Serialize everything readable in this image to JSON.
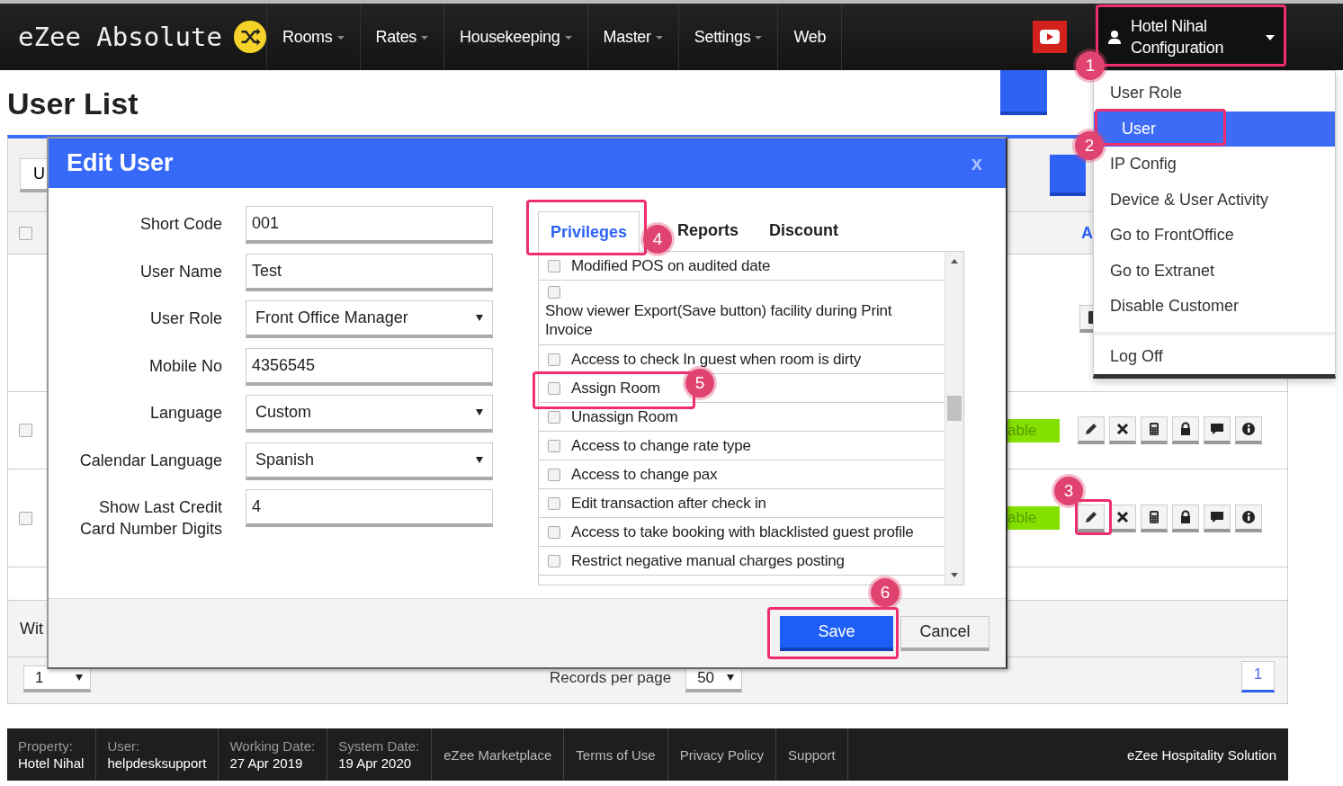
{
  "navbar": {
    "logo": "eZee Absolute",
    "items": [
      {
        "label": "Rooms",
        "dropdown": true
      },
      {
        "label": "Rates",
        "dropdown": true
      },
      {
        "label": "Housekeeping",
        "dropdown": true
      },
      {
        "label": "Master",
        "dropdown": true
      },
      {
        "label": "Settings",
        "dropdown": true
      },
      {
        "label": "Web",
        "dropdown": false
      }
    ],
    "user_menu": {
      "line_1": "Hotel Nihal",
      "line_2": "Configuration",
      "expanded": true
    }
  },
  "page_title": "User List",
  "user_menu_dropdown": {
    "items": [
      {
        "label": "User Role",
        "selected": false
      },
      {
        "label": "User",
        "selected": true
      },
      {
        "label": "IP Config",
        "selected": false
      },
      {
        "label": "Device & User Activity",
        "selected": false
      },
      {
        "label": "Go to FrontOffice",
        "selected": false
      },
      {
        "label": "Go to Extranet",
        "selected": false
      },
      {
        "label": "Disable Customer",
        "selected": false
      }
    ],
    "bottom_item": "Log Off"
  },
  "list_panel": {
    "toolbar_button": "U",
    "header": {
      "checked": false,
      "column_label": "A"
    },
    "rows": [
      {
        "kind": "partial"
      },
      {
        "kind": "user",
        "checked": false,
        "status": "able"
      },
      {
        "kind": "user",
        "checked": false,
        "status": "able"
      }
    ],
    "footer_text": "Wit",
    "page_select": "1",
    "records_label": "Records per page",
    "records_value": "50",
    "pages": [
      {
        "label": "1",
        "selected": true
      }
    ]
  },
  "edit_user_dialog": {
    "title": "Edit User",
    "close": "x",
    "fields": [
      {
        "label": "Short Code",
        "value": "001",
        "kind": "text"
      },
      {
        "label": "User Name",
        "value": "Test",
        "kind": "text"
      },
      {
        "label": "User Role",
        "value": "Front Office Manager",
        "kind": "select"
      },
      {
        "label": "Mobile No",
        "value": "4356545",
        "kind": "text"
      },
      {
        "label": "Language",
        "value": "Custom",
        "kind": "select"
      },
      {
        "label": "Calendar Language",
        "value": "Spanish",
        "kind": "select"
      },
      {
        "label": "Show Last Credit Card Number Digits",
        "value": "4",
        "kind": "text"
      }
    ],
    "tabs": [
      {
        "label": "Privileges",
        "selected": true,
        "step": "4"
      },
      {
        "label": "Reports",
        "selected": false
      },
      {
        "label": "Discount",
        "selected": false
      }
    ],
    "privileges": [
      {
        "label": "Modified POS on audited date",
        "checked": false,
        "kind": "inline"
      },
      {
        "label": "Show viewer Export(Save button) facility during Print Invoice",
        "checked": false,
        "kind": "stacked"
      },
      {
        "label": "Access to check In guest when room is dirty",
        "checked": false,
        "kind": "inline"
      },
      {
        "label": "Assign Room",
        "checked": false,
        "kind": "inline"
      },
      {
        "label": "Unassign Room",
        "checked": false,
        "kind": "inline"
      },
      {
        "label": "Access to change rate type",
        "checked": false,
        "kind": "inline"
      },
      {
        "label": "Access to change pax",
        "checked": false,
        "kind": "inline"
      },
      {
        "label": "Edit transaction after check in",
        "checked": false,
        "kind": "inline"
      },
      {
        "label": "Access to take booking with blacklisted guest profile",
        "checked": false,
        "kind": "inline"
      },
      {
        "label": "Restrict negative manual charges posting",
        "checked": false,
        "kind": "inline"
      }
    ],
    "save": "Save",
    "cancel": "Cancel"
  },
  "footer": {
    "info": [
      {
        "label": "Property:",
        "value": "Hotel Nihal"
      },
      {
        "label": "User:",
        "value": "helpdesksupport"
      },
      {
        "label": "Working Date:",
        "value": "27 Apr 2019"
      },
      {
        "label": "System Date:",
        "value": "19 Apr 2020"
      }
    ],
    "links": [
      "eZee Marketplace",
      "Terms of Use",
      "Privacy Policy",
      "Support"
    ],
    "brand": "eZee Hospitality Solution"
  },
  "annotations": [
    "1",
    "2",
    "3",
    "5",
    "6"
  ]
}
